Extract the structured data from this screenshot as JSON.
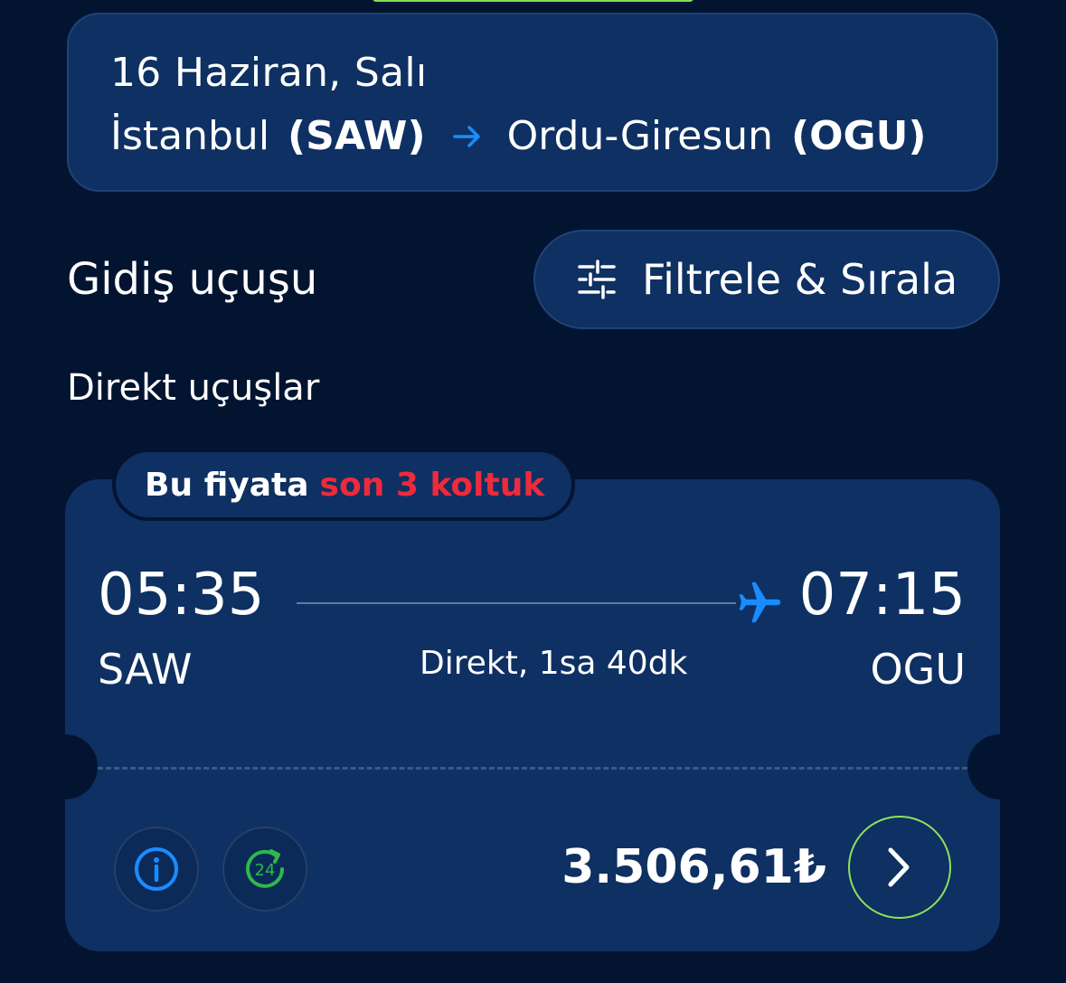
{
  "route": {
    "date": "16 Haziran, Salı",
    "origin_city": "İstanbul",
    "origin_code": "(SAW)",
    "destination_city": "Ordu-Giresun",
    "destination_code": "(OGU)",
    "arrow_icon": "arrow-right-icon"
  },
  "section_title": "Gidiş uçuşu",
  "filter_button": {
    "label": "Filtrele & Sırala",
    "icon": "sliders-icon"
  },
  "subsection_title": "Direkt uçuşlar",
  "flight": {
    "badge": {
      "prefix": "Bu fiyata",
      "highlight": "son 3 koltuk"
    },
    "departure_time": "05:35",
    "departure_code": "SAW",
    "arrival_time": "07:15",
    "arrival_code": "OGU",
    "duration": "Direkt, 1sa 40dk",
    "price": "3.506,61₺",
    "info_icon": "info-icon",
    "support_icon": "24h-support-icon",
    "next_icon": "chevron-right-icon",
    "plane_icon": "plane-icon"
  },
  "colors": {
    "background": "#031431",
    "card": "#0e3062",
    "accent_blue": "#1a8cff",
    "warning_red": "#ee2a3c",
    "accent_green": "#2fb84a",
    "button_outline_green": "#8ee05e"
  }
}
